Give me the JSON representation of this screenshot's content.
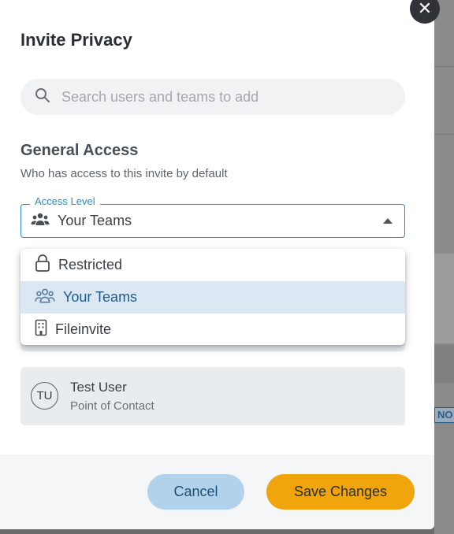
{
  "modal": {
    "title": "Invite Privacy",
    "close_symbol": "✕"
  },
  "search": {
    "placeholder": "Search users and teams to add",
    "icon": "search-icon"
  },
  "general_access": {
    "title": "General Access",
    "subtitle": "Who has access to this invite by default",
    "field_label": "Access Level",
    "selected_value": "Your Teams",
    "selected_icon": "teams-icon",
    "options": [
      {
        "label": "Restricted",
        "icon": "lock-icon",
        "selected": false
      },
      {
        "label": "Your Teams",
        "icon": "teams-icon",
        "selected": true
      },
      {
        "label": "Fileinvite",
        "icon": "building-icon",
        "selected": false
      }
    ]
  },
  "contact": {
    "initials": "TU",
    "name": "Test User",
    "role": "Point of Contact"
  },
  "footer": {
    "cancel_label": "Cancel",
    "save_label": "Save Changes"
  },
  "background": {
    "edge_text": "NO"
  },
  "colors": {
    "accent": "#2a8cc0",
    "save_button": "#f0a50c",
    "cancel_button": "#b2d1ea",
    "selected_option_bg": "#dbe7f3"
  }
}
